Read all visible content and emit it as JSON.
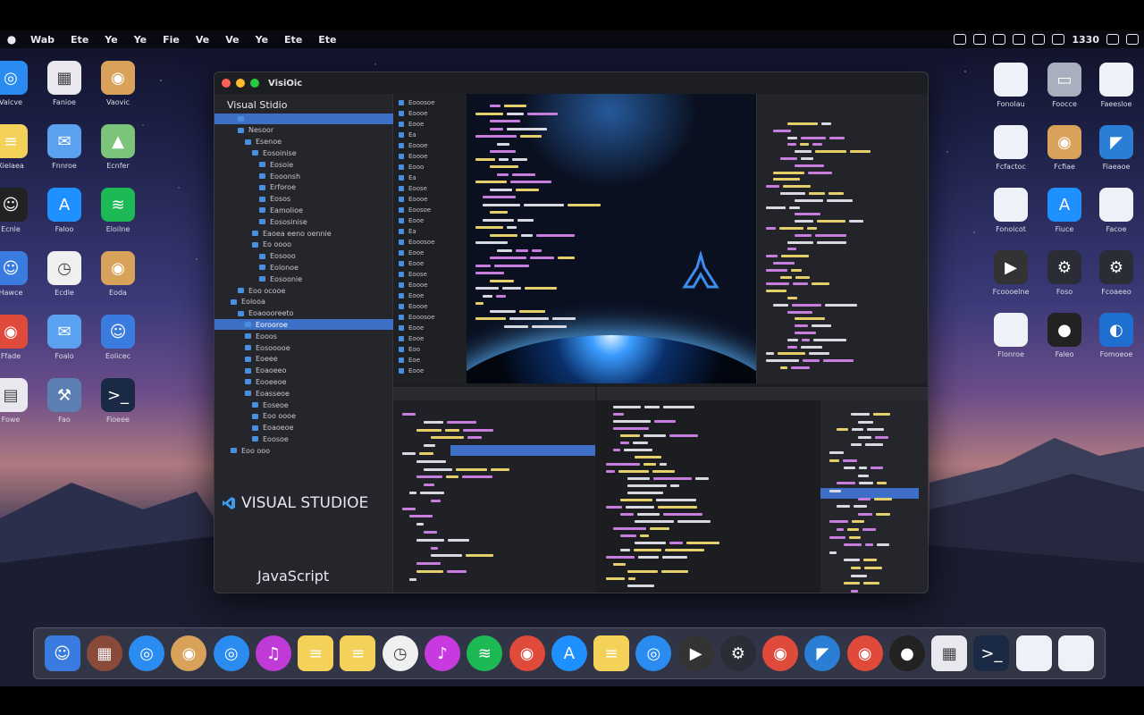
{
  "menubar": {
    "items": [
      "Wab",
      "Ete",
      "Ye",
      "Ye",
      "Fie",
      "Ve",
      "Ve",
      "Ye",
      "Ete",
      "Ete"
    ],
    "clock": "1330"
  },
  "window": {
    "title": "VisiOic",
    "sidebar_header": "Visual Stidio",
    "banner": "VISUAL STUDIOE",
    "js_label": "JavaScript"
  },
  "colors": {
    "accent": "#3d6fc6",
    "code_purple": "#c77ddc",
    "code_yellow": "#e5cf6b",
    "code_white": "#d8d8e0"
  },
  "desktop_left": [
    {
      "icon": "safari-icon",
      "label": "Valcve"
    },
    {
      "icon": "preview-icon",
      "label": "Fanioe"
    },
    {
      "icon": "photos-icon",
      "label": "Vaovic"
    },
    {
      "icon": "notes-icon",
      "label": "Xielaea"
    },
    {
      "icon": "mail-icon",
      "label": "Fnnroe"
    },
    {
      "icon": "maps-icon",
      "label": "Ecnfer"
    },
    {
      "icon": "theater-icon",
      "label": "Ecnle"
    },
    {
      "icon": "app-store-icon",
      "label": "Faloo"
    },
    {
      "icon": "spotify-icon",
      "label": "Eloilne"
    },
    {
      "icon": "finder-icon",
      "label": "Hawce"
    },
    {
      "icon": "clock-icon",
      "label": "Ecdle"
    },
    {
      "icon": "photos-icon",
      "label": "Eoda"
    },
    {
      "icon": "chrome-icon",
      "label": "Ffade"
    },
    {
      "icon": "mail-icon",
      "label": "Foalo"
    },
    {
      "icon": "finder-icon",
      "label": "Eolicec"
    },
    {
      "icon": "calendar-icon",
      "label": "Fowe"
    },
    {
      "icon": "xcode-icon",
      "label": "Fao"
    },
    {
      "icon": "terminal-icon",
      "label": "Fioeee"
    }
  ],
  "desktop_right": [
    {
      "icon": "document-icon",
      "label": "Fonolau"
    },
    {
      "icon": "disk-icon",
      "label": "Foocce"
    },
    {
      "icon": "document-icon",
      "label": "Faeesloe"
    },
    {
      "icon": "document-icon",
      "label": "Fcfactoc"
    },
    {
      "icon": "photos-icon",
      "label": "Fcfiae"
    },
    {
      "icon": "vsc-icon",
      "label": "Fiaeaoe"
    },
    {
      "icon": "document-icon",
      "label": "Fonoicot"
    },
    {
      "icon": "app-store-icon",
      "label": "Fiuce"
    },
    {
      "icon": "document-icon",
      "label": "Facoe"
    },
    {
      "icon": "quicktime-icon",
      "label": "Fcoooelne"
    },
    {
      "icon": "steam-icon",
      "label": "Foso"
    },
    {
      "icon": "steam-icon",
      "label": "Fcoaeeo"
    },
    {
      "icon": "document-icon",
      "label": "Flonroe"
    },
    {
      "icon": "github-icon",
      "label": "Faleo"
    },
    {
      "icon": "edge-icon",
      "label": "Fomoeoe"
    }
  ],
  "sidebar_rows": [
    "",
    "Nesoor",
    "Esenoe",
    "Eosoinise",
    "Eosoie",
    "Eooonsh",
    "Erforoe",
    "Eosos",
    "Eamolioe",
    "Eososinise",
    "Eaoea eeno oennie",
    "Eo oooo",
    "Eosooo",
    "Eolonoe",
    "Eosoonie",
    "Eoo ocooe",
    "Eolooa",
    "Eoaoooreeto",
    "Eorooroe",
    "Eooos",
    "Eosooooe",
    "Eoeee",
    "Eoaoeeo",
    "Eooeeoe",
    "Eoasseoe",
    "Eoseoe",
    "Eoo oooe",
    "Eoaoeoe",
    "Eoosoe",
    "Eoo ooo"
  ],
  "filelist_rows": [
    "Eooosoe",
    "Eoooe",
    "Eooe",
    "Ea",
    "Eoooe",
    "Eoooe",
    "Eooo",
    "Ea",
    "Eoose",
    "Eoooe",
    "Eoosoe",
    "Eooe",
    "Ea",
    "Eooosoe",
    "Eooe",
    "Eooe",
    "Eoose",
    "Eoooe",
    "Eooe",
    "Eoooe",
    "Eooosoe",
    "Eooe",
    "Eooe",
    "Eoo",
    "Eoe",
    "Eooe"
  ],
  "dock": [
    {
      "icon": "finder-icon"
    },
    {
      "icon": "launchpad-icon"
    },
    {
      "icon": "safari-icon"
    },
    {
      "icon": "photos-icon"
    },
    {
      "icon": "safari-icon"
    },
    {
      "icon": "music-icon"
    },
    {
      "icon": "notes-icon"
    },
    {
      "icon": "notes-icon"
    },
    {
      "icon": "clock-icon"
    },
    {
      "icon": "itunes-icon"
    },
    {
      "icon": "spotify-icon"
    },
    {
      "icon": "chrome-icon"
    },
    {
      "icon": "app-store-icon"
    },
    {
      "icon": "notes-icon"
    },
    {
      "icon": "safari-icon"
    },
    {
      "icon": "quicktime-icon"
    },
    {
      "icon": "steam-icon"
    },
    {
      "icon": "chrome-icon"
    },
    {
      "icon": "vsc-icon"
    },
    {
      "icon": "chrome-icon"
    },
    {
      "icon": "github-icon"
    },
    {
      "icon": "preview-icon"
    },
    {
      "icon": "terminal-icon"
    },
    {
      "icon": "document-icon"
    },
    {
      "icon": "document-icon"
    }
  ]
}
